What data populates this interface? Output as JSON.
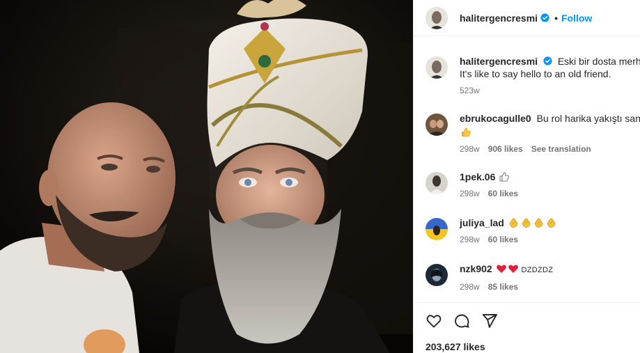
{
  "header": {
    "username": "halitergencresmi",
    "separator": "•",
    "follow_label": "Follow"
  },
  "caption": {
    "username": "halitergencresmi",
    "line1": "Eski bir dosta merhaba",
    "line2": "It's like to say hello to an old friend.",
    "time": "523w"
  },
  "comments": [
    {
      "username": "ebrukocagulle0",
      "text": "Bu rol harika yakıştı sana",
      "emoji": "thumbs-up",
      "time": "298w",
      "likes": "906 likes",
      "extra": "See translation",
      "avatar_color": "#7a5a3c"
    },
    {
      "username": "1pek.06",
      "text": "",
      "emoji": "thumbs-up",
      "time": "298w",
      "likes": "60 likes",
      "avatar_color": "#cfcac4"
    },
    {
      "username": "juliya_lad",
      "text": "",
      "emoji": "clapping-hands-x4",
      "time": "298w",
      "likes": "60 likes",
      "avatar_color": "#3a4a78"
    },
    {
      "username": "nzk902",
      "text": "DZDZDZ",
      "emoji": "red-hearts-x2",
      "time": "298w",
      "likes": "85 likes",
      "avatar_color": "#22303e"
    }
  ],
  "actions": {
    "like_icon": "heart-icon",
    "comment_icon": "comment-icon",
    "share_icon": "send-icon"
  },
  "likes_count": "203,627 likes",
  "colors": {
    "accent": "#0095f6",
    "verified": "#0095f6",
    "muted": "#737373",
    "text": "#262626",
    "heart_emoji": "#e0233b",
    "clap_emoji": "#f5b51e"
  }
}
